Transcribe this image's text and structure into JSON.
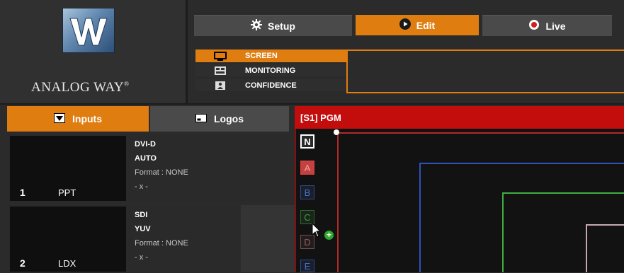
{
  "brand": {
    "name": "ANALOG WAY",
    "registered": "®"
  },
  "modes": [
    {
      "label": "Setup",
      "icon": "gear-icon",
      "active": false
    },
    {
      "label": "Edit",
      "icon": "play-circle-icon",
      "active": true
    },
    {
      "label": "Live",
      "icon": "record-dot-icon",
      "active": false
    }
  ],
  "display_list": [
    {
      "label": "SCREEN",
      "icon": "monitor-icon",
      "active": true
    },
    {
      "label": "MONITORING",
      "icon": "multiview-icon",
      "active": false
    },
    {
      "label": "CONFIDENCE",
      "icon": "presenter-icon",
      "active": false
    }
  ],
  "source_tabs": [
    {
      "label": "Inputs",
      "icon": "dropdown-arrow-icon",
      "active": true
    },
    {
      "label": "Logos",
      "icon": "logo-frame-icon",
      "active": false
    }
  ],
  "inputs": [
    {
      "number": "1",
      "name": "PPT",
      "connector": "DVI-D",
      "mode": "AUTO",
      "format": "Format : NONE",
      "extra": "- x -"
    },
    {
      "number": "2",
      "name": "LDX",
      "connector": "SDI",
      "mode": "YUV",
      "format": "Format : NONE",
      "extra": "- x -"
    }
  ],
  "pgm": {
    "title": "[S1] PGM"
  },
  "layers": [
    "N",
    "A",
    "B",
    "C",
    "D",
    "E"
  ],
  "colors": {
    "accent": "#e07d10",
    "pgm_red": "#c30d0d",
    "layer_a": "#b02a2a",
    "layer_b": "#2f52b8",
    "layer_c": "#3fae3f",
    "layer_d": "#c8a8b0"
  }
}
